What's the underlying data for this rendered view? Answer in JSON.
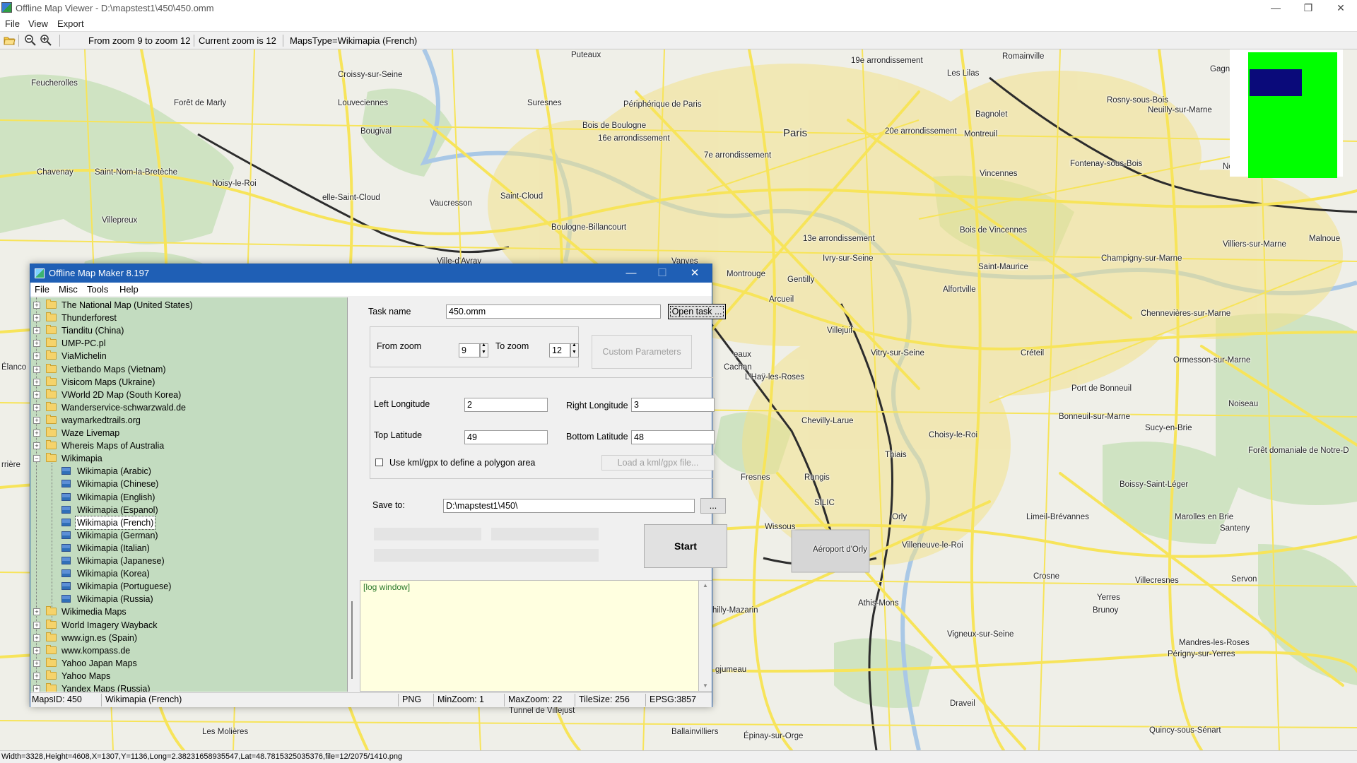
{
  "window": {
    "title": "Offline Map Viewer - D:\\mapstest1\\450\\450.omm",
    "controls": {
      "minimize": "—",
      "maximize": "❐",
      "close": "✕"
    }
  },
  "menu": {
    "file": "File",
    "view": "View",
    "export": "Export"
  },
  "toolbar": {
    "zoom_range": "From zoom 9 to zoom 12",
    "current_zoom": "Current zoom is 12",
    "maps_type": "MapsType=Wikimapia (French)"
  },
  "map": {
    "labels": {
      "puteaux": "Puteaux",
      "romainville": "Romainville",
      "arr19": "19e arrondissement",
      "feucherolles": "Feucherolles",
      "croissy": "Croissy-sur-Seine",
      "leslilas": "Les Lilas",
      "gagny": "Gagn",
      "fortmarly": "Forêt de Marly",
      "louveciennes": "Louveciennes",
      "suresnes": "Suresnes",
      "peripherique": "Périphérique de Paris",
      "bagnolet": "Bagnolet",
      "rosny": "Rosny-sous-Bois",
      "neuilly": "Neuilly-sur-Marne",
      "boisboulogne": "Bois de Boulogne",
      "paris": "Paris",
      "bougival": "Bougival",
      "arr16": "16e arrondissement",
      "arr20": "20e arrondissement",
      "montreuil": "Montreuil",
      "arr7": "7e arrondissement",
      "fontenay": "Fontenay-sous-Bois",
      "noisyle": "Noisy-le",
      "chavenay": "Chavenay",
      "saintnom": "Saint-Nom-la-Bretèche",
      "noisyleroi": "Noisy-le-Roi",
      "vincennes": "Vincennes",
      "ellesaintcloud": "elle-Saint-Cloud",
      "vaucresson": "Vaucresson",
      "saintcloud": "Saint-Cloud",
      "villepreux": "Villepreux",
      "boulogne": "Boulogne-Billancourt",
      "boisvincennes": "Bois de Vincennes",
      "malnoue": "Malnoue",
      "arr13": "13e arrondissement",
      "villedavray": "Ville-d'Avray",
      "vanves": "Vanves",
      "ivry": "Ivry-sur-Seine",
      "champigny": "Champigny-sur-Marne",
      "villiers": "Villiers-sur-Marne",
      "saintmaurice": "Saint-Maurice",
      "montrouge": "Montrouge",
      "gentilly": "Gentilly",
      "alfortville": "Alfortville",
      "arcueil": "Arcueil",
      "chennevieres": "Chennevières-sur-Marne",
      "elancourt": "Élanco",
      "villejuif": "Villejuif",
      "vitry": "Vitry-sur-Seine",
      "creteil": "Créteil",
      "sceaux": "eaux",
      "ormesson": "Ormesson-sur-Marne",
      "lhay": "L'Haÿ-les-Roses",
      "cachan": "Cachan",
      "portbonneuil": "Port de Bonneuil",
      "noiseau": "Noiseau",
      "chevilly": "Chevilly-Larue",
      "bonneuil": "Bonneuil-sur-Marne",
      "sucy": "Sucy-en-Brie",
      "choisy": "Choisy-le-Roi",
      "foretnotre": "Forêt domaniale de Notre-D",
      "rriere": "rrière",
      "thiais": "Thiais",
      "fresnes": "Fresnes",
      "rungis": "Rungis",
      "boissy": "Boissy-Saint-Léger",
      "silic": "SILIC",
      "limeil": "Limeil-Brévannes",
      "marolles": "Marolles en Brie",
      "orly": "Orly",
      "wissous": "Wissous",
      "santeny": "Santeny",
      "villeneuveleroi": "Villeneuve-le-Roi",
      "aeroport": "Aéroport d'Orly",
      "crosne": "Crosne",
      "villecresnes": "Villecresnes",
      "servon": "Servon",
      "yerres": "Yerres",
      "athis": "Athis-Mons",
      "brunoy": "Brunoy",
      "chilly": "hilly-Mazarin",
      "vigneux": "Vigneux-sur-Seine",
      "mandres": "Mandres-les-Roses",
      "perigny": "Périgny-sur-Yerres",
      "jumeau": "gjumeau",
      "draveil": "Draveil",
      "tunnel": "Tunnel de Villejust",
      "molieres": "Les Molières",
      "ballainvilliers": "Ballainvilliers",
      "epinay": "Épinay-sur-Orge",
      "quincy": "Quincy-sous-Sénart"
    }
  },
  "status": {
    "text": "Width=3328,Height=4608,X=1307,Y=1136,Long=2.38231658935547,Lat=48.7815325035376,file=12/2075/1410.png"
  },
  "maker": {
    "title": "Offline Map Maker 8.197",
    "menu": {
      "file": "File",
      "misc": "Misc",
      "tools": "Tools",
      "help": "Help"
    },
    "tree": {
      "top_items": [
        "The National Map (United States)",
        "Thunderforest",
        "Tianditu (China)",
        "UMP-PC.pl",
        "ViaMichelin",
        "Vietbando Maps (Vietnam)",
        "Visicom Maps (Ukraine)",
        "VWorld 2D Map (South Korea)",
        "Wanderservice-schwarzwald.de",
        "waymarkedtrails.org",
        "Waze Livemap",
        "Whereis Maps of Australia",
        "Wikimapia"
      ],
      "wikimapia_children": [
        "Wikimapia (Arabic)",
        "Wikimapia (Chinese)",
        "Wikimapia (English)",
        "Wikimapia (Espanol)",
        "Wikimapia (French)",
        "Wikimapia (German)",
        "Wikimapia (Italian)",
        "Wikimapia (Japanese)",
        "Wikimapia (Korea)",
        "Wikimapia (Portuguese)",
        "Wikimapia (Russia)"
      ],
      "bottom_items": [
        "Wikimedia Maps",
        "World Imagery Wayback",
        "www.ign.es (Spain)",
        "www.kompass.de",
        "Yahoo Japan Maps",
        "Yahoo Maps",
        "Yandex Maps (Russia)"
      ],
      "selected": "Wikimapia (French)"
    },
    "form": {
      "task_name_label": "Task name",
      "task_name_value": "450.omm",
      "open_task": "Open task ...",
      "from_zoom_label": "From zoom",
      "from_zoom_value": "9",
      "to_zoom_label": "To zoom",
      "to_zoom_value": "12",
      "custom_parameters": "Custom Parameters",
      "left_lon_label": "Left Longitude",
      "left_lon_value": "2",
      "right_lon_label": "Right Longitude",
      "right_lon_value": "3",
      "top_lat_label": "Top Latitude",
      "top_lat_value": "49",
      "bottom_lat_label": "Bottom Latitude",
      "bottom_lat_value": "48",
      "kml_label": "Use kml/gpx to define a polygon area",
      "load_kml": "Load a kml/gpx file...",
      "save_to_label": "Save to:",
      "save_to_value": "D:\\mapstest1\\450\\",
      "browse": "...",
      "start": "Start"
    },
    "log": "[log window]",
    "statusbar": {
      "maps_id": "MapsID: 450",
      "maps_name": "Wikimapia (French)",
      "format": "PNG",
      "min_zoom": "MinZoom: 1",
      "max_zoom": "MaxZoom: 22",
      "tile_size": "TileSize: 256",
      "epsg": "EPSG:3857"
    }
  },
  "colors": {
    "road_yellow": "#f7e45a",
    "land": "#efefe8",
    "forest": "#cfe3c2",
    "water": "#a9c8e6",
    "tree_bg": "#c3dcc0",
    "log_bg": "#ffffe0",
    "title_blue": "#1f5fb5"
  }
}
